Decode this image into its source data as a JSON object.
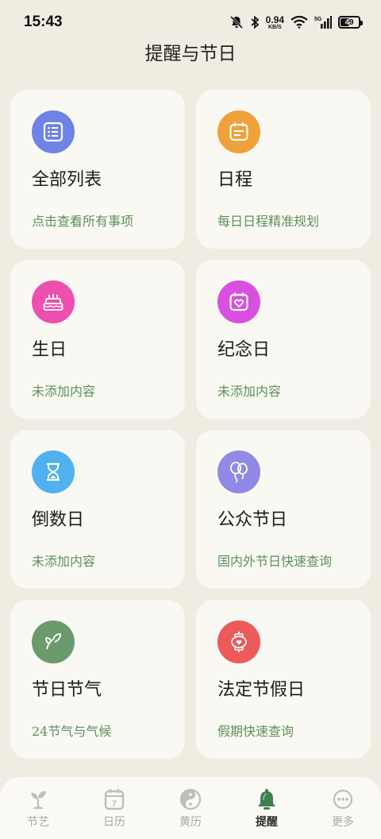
{
  "status": {
    "time": "15:43",
    "net_speed_value": "0.94",
    "net_speed_unit": "KB/S",
    "battery": "49",
    "signal_label": "5G"
  },
  "header": {
    "title": "提醒与节日"
  },
  "cards": [
    {
      "title": "全部列表",
      "subtitle": "点击查看所有事项",
      "color": "#6f82e6",
      "icon": "list-icon"
    },
    {
      "title": "日程",
      "subtitle": "每日日程精准规划",
      "color": "#f1a13a",
      "icon": "calendar-icon"
    },
    {
      "title": "生日",
      "subtitle": "未添加内容",
      "color": "#ee4fae",
      "icon": "cake-icon"
    },
    {
      "title": "纪念日",
      "subtitle": "未添加内容",
      "color": "#d94fe0",
      "icon": "heart-calendar-icon"
    },
    {
      "title": "倒数日",
      "subtitle": "未添加内容",
      "color": "#50b1f0",
      "icon": "hourglass-icon"
    },
    {
      "title": "公众节日",
      "subtitle": "国内外节日快速查询",
      "color": "#9289e6",
      "icon": "balloons-icon"
    },
    {
      "title": "节日节气",
      "subtitle": "24节气与气候",
      "color": "#6b9a6c",
      "icon": "leaf-icon"
    },
    {
      "title": "法定节假日",
      "subtitle": "假期快速查询",
      "color": "#ec5a5a",
      "icon": "lantern-icon"
    }
  ],
  "tabs": [
    {
      "label": "节艺",
      "icon": "sprout-icon",
      "active": false
    },
    {
      "label": "日历",
      "icon": "calendar-7-icon",
      "active": false,
      "badge": "7"
    },
    {
      "label": "黄历",
      "icon": "taiji-icon",
      "active": false
    },
    {
      "label": "提醒",
      "icon": "bell-icon",
      "active": true
    },
    {
      "label": "更多",
      "icon": "more-icon",
      "active": false
    }
  ]
}
